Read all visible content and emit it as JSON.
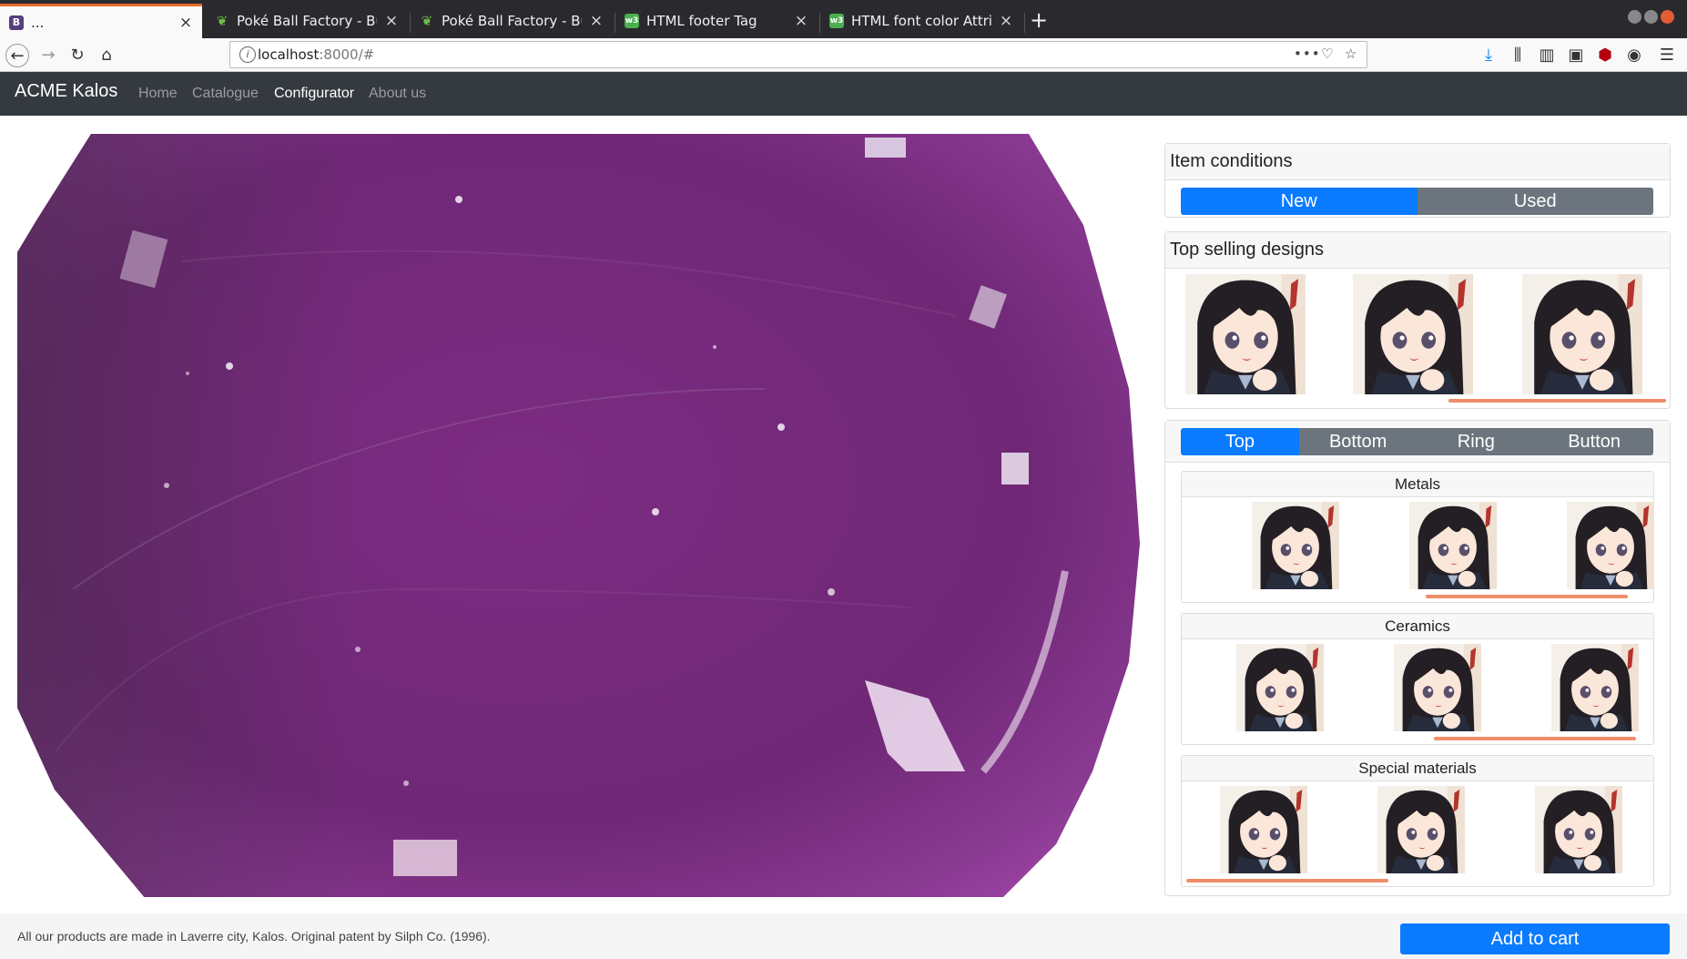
{
  "browser": {
    "tabs": [
      {
        "title": "...",
        "icon": "bootstrap-icon"
      },
      {
        "title": "Poké Ball Factory - Bulbapedia",
        "icon": "bulbapedia-icon"
      },
      {
        "title": "Poké Ball Factory - Bulbapedia",
        "icon": "bulbapedia-icon"
      },
      {
        "title": "HTML footer Tag",
        "icon": "w3schools-icon"
      },
      {
        "title": "HTML font color Attribute",
        "icon": "w3schools-icon"
      }
    ],
    "url_host": "localhost",
    "url_rest": ":8000/#"
  },
  "site": {
    "brand": "ACME Kalos",
    "nav": [
      "Home",
      "Catalogue",
      "Configurator",
      "About us"
    ],
    "active_nav": "Configurator"
  },
  "conditions": {
    "title": "Item conditions",
    "options": [
      "New",
      "Used"
    ],
    "selected": "New"
  },
  "top_designs": {
    "title": "Top selling designs",
    "scroll_position": 0.65
  },
  "parts": {
    "tabs": [
      "Top",
      "Bottom",
      "Ring",
      "Button"
    ],
    "selected": "Top",
    "groups": [
      {
        "title": "Metals",
        "scroll_position": 0.7
      },
      {
        "title": "Ceramics",
        "scroll_position": 0.6
      },
      {
        "title": "Special materials",
        "scroll_position": 0.1
      }
    ]
  },
  "footer": {
    "text": "All our products are made in Laverre city, Kalos. Original patent by Silph Co. (1996).",
    "cart_label": "Add to cart"
  },
  "colors": {
    "ball": "#7a2a80",
    "accent": "#0a7bff",
    "navbar": "#343a40",
    "scroll_indicator": "#ef8d68"
  }
}
